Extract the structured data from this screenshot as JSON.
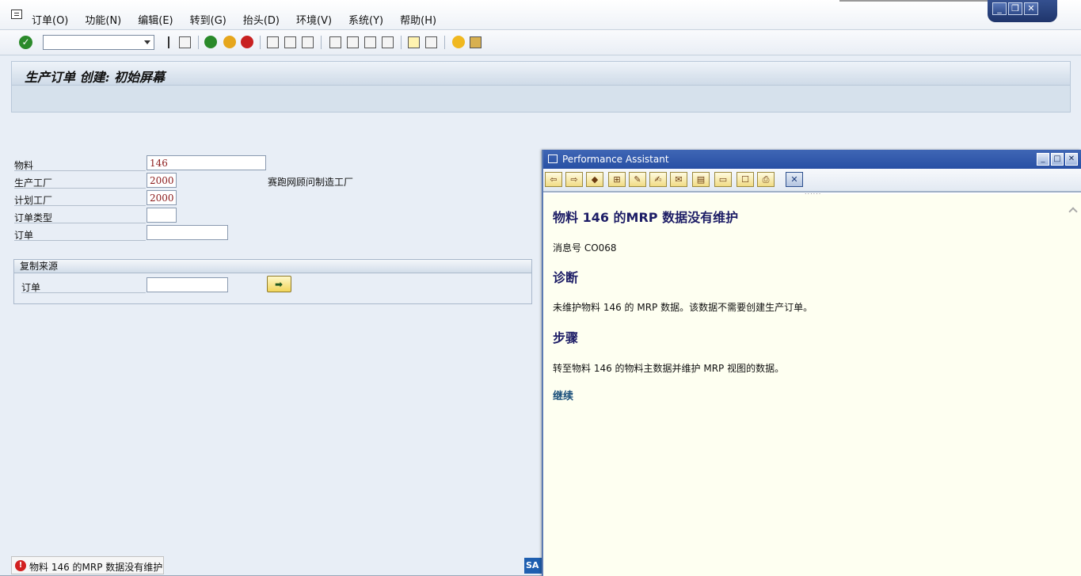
{
  "menubar": {
    "items": [
      "订单(O)",
      "功能(N)",
      "编辑(E)",
      "转到(G)",
      "抬头(D)",
      "环境(V)",
      "系统(Y)",
      "帮助(H)"
    ]
  },
  "toolbar": {
    "command_field": ""
  },
  "screen": {
    "title": "生产订单 创建: 初始屏幕"
  },
  "form": {
    "material_label": "物料",
    "material_value": "146",
    "prod_plant_label": "生产工厂",
    "prod_plant_value": "2000",
    "prod_plant_desc": "赛跑网顾问制造工厂",
    "plan_plant_label": "计划工厂",
    "plan_plant_value": "2000",
    "order_type_label": "订单类型",
    "order_type_value": "",
    "order_label": "订单",
    "order_value": ""
  },
  "copy_from": {
    "title": "复制来源",
    "order_label": "订单",
    "order_value": ""
  },
  "status": {
    "message": "物料 146 的MRP 数据没有维护",
    "type": "error"
  },
  "performance_assistant": {
    "window_title": "Performance Assistant",
    "heading": "物料  146 的MRP 数据没有维护",
    "message_no": "消息号  CO068",
    "diagnosis_title": "诊断",
    "diagnosis_text": "未维护物料  146 的  MRP 数据。该数据不需要创建生产订单。",
    "procedure_title": "步骤",
    "procedure_text": "转至物料  146 的物料主数据并维护  MRP 视图的数据。",
    "continue_link": "继续"
  },
  "colors": {
    "title_blue": "#1d1d66",
    "help_bg": "#fefff1",
    "field_text": "#8b1a1a",
    "error_red": "#d22020"
  }
}
